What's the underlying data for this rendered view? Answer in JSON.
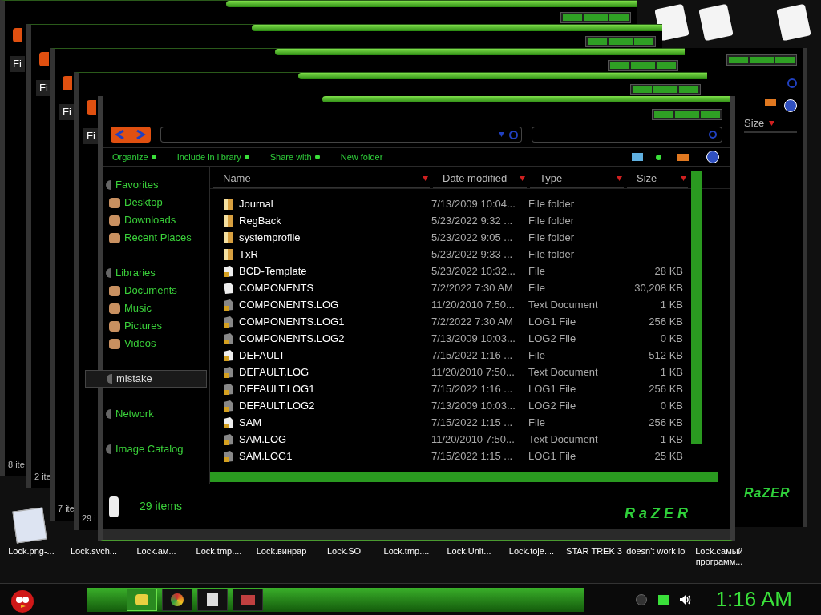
{
  "back_windows": [
    {
      "menu": "Fi",
      "status": "8 ite"
    },
    {
      "menu": "Fi",
      "status": "2 ite"
    },
    {
      "menu": "Fi",
      "status": "7 ite"
    },
    {
      "menu": "Fi",
      "status": "29 i"
    }
  ],
  "right_window": {
    "column": "Size",
    "brand": "RaZER"
  },
  "toolbar": [
    {
      "label": "Organize"
    },
    {
      "label": "Include in library"
    },
    {
      "label": "Share with"
    },
    {
      "label": "New folder"
    }
  ],
  "sidebar": [
    {
      "label": "Favorites",
      "selected": false,
      "children": [
        {
          "label": "Desktop",
          "selected": false
        },
        {
          "label": "Downloads",
          "selected": false
        },
        {
          "label": "Recent Places",
          "selected": false
        }
      ]
    },
    {
      "label": "Libraries",
      "selected": false,
      "children": [
        {
          "label": "Documents",
          "selected": false
        },
        {
          "label": "Music",
          "selected": false
        },
        {
          "label": "Pictures",
          "selected": false
        },
        {
          "label": "Videos",
          "selected": false
        }
      ]
    },
    {
      "label": "mistake",
      "selected": true
    },
    {
      "label": "Network",
      "selected": false
    },
    {
      "label": "Image Catalog",
      "selected": false
    }
  ],
  "columns": [
    "Name",
    "Date modified",
    "Type",
    "Size"
  ],
  "rows": [
    {
      "kind": "folder",
      "name": "Journal",
      "date": "7/13/2009 10:04...",
      "type": "File folder",
      "size": ""
    },
    {
      "kind": "folder",
      "name": "RegBack",
      "date": "5/23/2022 9:32 ...",
      "type": "File folder",
      "size": ""
    },
    {
      "kind": "folder",
      "name": "systemprofile",
      "date": "5/23/2022 9:05 ...",
      "type": "File folder",
      "size": ""
    },
    {
      "kind": "folder",
      "name": "TxR",
      "date": "5/23/2022 9:33 ...",
      "type": "File folder",
      "size": ""
    },
    {
      "kind": "file",
      "name": "BCD-Template",
      "date": "5/23/2022 10:32...",
      "type": "File",
      "size": "28 KB"
    },
    {
      "kind": "blank",
      "name": "COMPONENTS",
      "date": "7/2/2022 7:30 AM",
      "type": "File",
      "size": "30,208 KB"
    },
    {
      "kind": "locked",
      "name": "COMPONENTS.LOG",
      "date": "11/20/2010 7:50...",
      "type": "Text Document",
      "size": "1 KB"
    },
    {
      "kind": "locked",
      "name": "COMPONENTS.LOG1",
      "date": "7/2/2022 7:30 AM",
      "type": "LOG1 File",
      "size": "256 KB"
    },
    {
      "kind": "locked",
      "name": "COMPONENTS.LOG2",
      "date": "7/13/2009 10:03...",
      "type": "LOG2 File",
      "size": "0 KB"
    },
    {
      "kind": "file",
      "name": "DEFAULT",
      "date": "7/15/2022 1:16 ...",
      "type": "File",
      "size": "512 KB"
    },
    {
      "kind": "locked",
      "name": "DEFAULT.LOG",
      "date": "11/20/2010 7:50...",
      "type": "Text Document",
      "size": "1 KB"
    },
    {
      "kind": "locked",
      "name": "DEFAULT.LOG1",
      "date": "7/15/2022 1:16 ...",
      "type": "LOG1 File",
      "size": "256 KB"
    },
    {
      "kind": "locked",
      "name": "DEFAULT.LOG2",
      "date": "7/13/2009 10:03...",
      "type": "LOG2 File",
      "size": "0 KB"
    },
    {
      "kind": "file",
      "name": "SAM",
      "date": "7/15/2022 1:15 ...",
      "type": "File",
      "size": "256 KB"
    },
    {
      "kind": "locked",
      "name": "SAM.LOG",
      "date": "11/20/2010 7:50...",
      "type": "Text Document",
      "size": "1 KB"
    },
    {
      "kind": "locked",
      "name": "SAM.LOG1",
      "date": "7/15/2022 1:15 ...",
      "type": "LOG1 File",
      "size": "25 KB"
    }
  ],
  "status": "29 items",
  "brand": "RaZER",
  "desktop_icons": [
    "Lock.png-...",
    "Lock.svch...",
    "Lock.ам...",
    "Lock.tmp....",
    "Lock.винрар",
    "Lock.SO",
    "Lock.tmp....",
    "Lock.Unit...",
    "Lock.toje....",
    "STAR TREK 3",
    "doesn't work lol",
    "Lock.самый программ..."
  ],
  "taskbar": [
    {
      "selected": true
    },
    {
      "selected": false
    },
    {
      "selected": false
    },
    {
      "selected": false
    }
  ],
  "clock": "1:16 AM"
}
